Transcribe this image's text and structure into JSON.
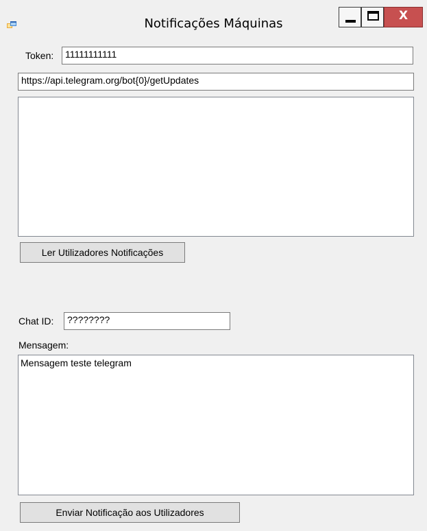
{
  "window": {
    "title": "Notificações Máquinas",
    "icon": "app-window-icon",
    "controls": {
      "minimize_icon": "minimize-icon",
      "maximize_icon": "maximize-icon",
      "close_label": "X"
    },
    "colors": {
      "close_button": "#c75050",
      "background": "#f0f0f0"
    }
  },
  "form": {
    "token_label": "Token:",
    "token_value": "11111111111",
    "url_value": "https://api.telegram.org/bot{0}/getUpdates",
    "updates_output": "",
    "read_button_label": "Ler Utilizadores Notificações",
    "chat_id_label": "Chat ID:",
    "chat_id_value": "????????",
    "message_label": "Mensagem:",
    "message_value": "Mensagem teste telegram",
    "send_button_label": "Enviar Notificação aos Utilizadores"
  }
}
